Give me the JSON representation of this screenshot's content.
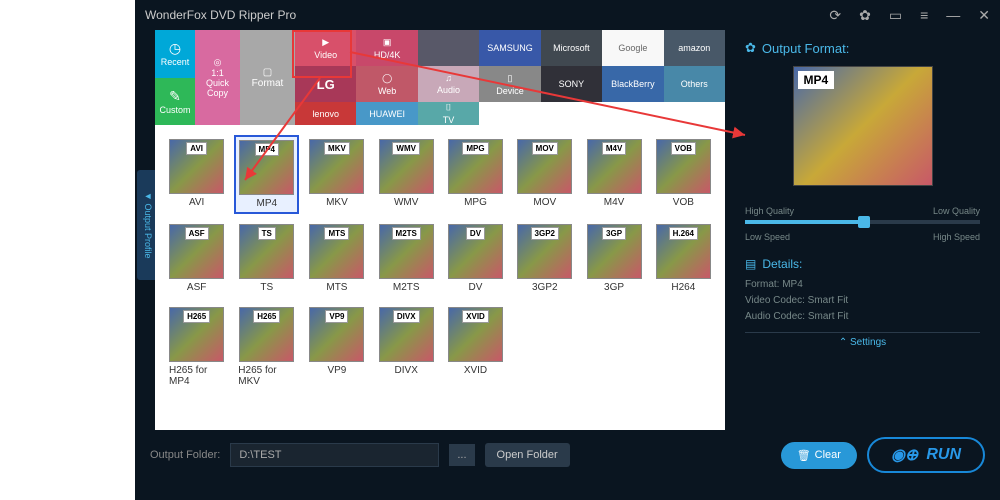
{
  "app_title": "WonderFox DVD Ripper Pro",
  "sidebar": {
    "tab_label": "◄ Output Profile"
  },
  "categories": {
    "recent": "Recent",
    "custom": "Custom",
    "quick_copy": "1:1\nQuick\nCopy",
    "format": "Format",
    "video": "Video",
    "hd": "HD/4K",
    "web": "Web",
    "audio": "Audio",
    "device": "Device",
    "apple": "",
    "samsung": "SAMSUNG",
    "microsoft": "Microsoft",
    "google": "Google",
    "lg": "LG",
    "amazon": "amazon",
    "sony": "SONY",
    "blackberry": "BlackBerry",
    "lenovo": "lenovo",
    "huawei": "HUAWEI",
    "tv": "TV",
    "others": "Others"
  },
  "formats": [
    {
      "badge": "AVI",
      "label": "AVI"
    },
    {
      "badge": "MP4",
      "label": "MP4",
      "selected": true
    },
    {
      "badge": "MKV",
      "label": "MKV"
    },
    {
      "badge": "WMV",
      "label": "WMV"
    },
    {
      "badge": "MPG",
      "label": "MPG"
    },
    {
      "badge": "MOV",
      "label": "MOV"
    },
    {
      "badge": "M4V",
      "label": "M4V"
    },
    {
      "badge": "VOB",
      "label": "VOB"
    },
    {
      "badge": "ASF",
      "label": "ASF"
    },
    {
      "badge": "TS",
      "label": "TS"
    },
    {
      "badge": "MTS",
      "label": "MTS"
    },
    {
      "badge": "M2TS",
      "label": "M2TS"
    },
    {
      "badge": "DV",
      "label": "DV"
    },
    {
      "badge": "3GP2",
      "label": "3GP2"
    },
    {
      "badge": "3GP",
      "label": "3GP"
    },
    {
      "badge": "H.264",
      "label": "H264"
    },
    {
      "badge": "H265",
      "label": "H265 for MP4"
    },
    {
      "badge": "H265",
      "label": "H265 for MKV"
    },
    {
      "badge": "VP9",
      "label": "VP9"
    },
    {
      "badge": "DIVX",
      "label": "DIVX"
    },
    {
      "badge": "XVID",
      "label": "XVID"
    }
  ],
  "output": {
    "header": "Output Format:",
    "preview_badge": "MP4",
    "quality_high": "High Quality",
    "quality_low": "Low Quality",
    "speed_low": "Low Speed",
    "speed_high": "High Speed",
    "details_header": "Details:",
    "detail_format": "Format: MP4",
    "detail_vcodec": "Video Codec: Smart Fit",
    "detail_acodec": "Audio Codec: Smart Fit",
    "settings": "Settings"
  },
  "bottom": {
    "folder_label": "Output Folder:",
    "folder_value": "D:\\TEST",
    "browse": "...",
    "open_folder": "Open Folder",
    "clear": "Clear",
    "run": "RUN"
  }
}
